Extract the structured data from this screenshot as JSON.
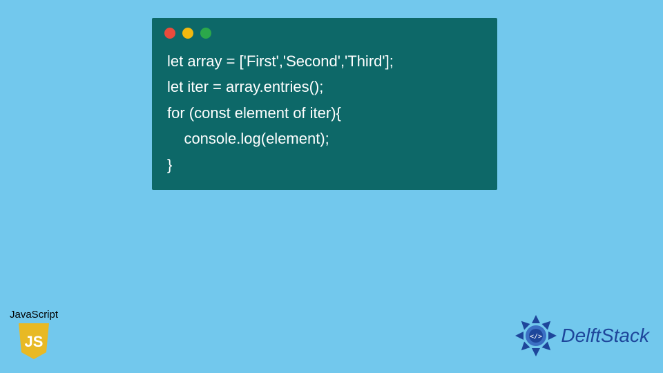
{
  "code": {
    "lines": [
      "let array = ['First','Second','Third'];",
      "let iter = array.entries();",
      "for (const element of iter){",
      "    console.log(element);",
      "}"
    ]
  },
  "js_badge": {
    "label": "JavaScript",
    "shield_text": "JS"
  },
  "brand": {
    "name": "DelftStack"
  },
  "colors": {
    "background": "#72c8ed",
    "window": "#0d6868",
    "code_text": "#ffffff",
    "brand": "#1e469b",
    "shield": "#e8b924"
  }
}
